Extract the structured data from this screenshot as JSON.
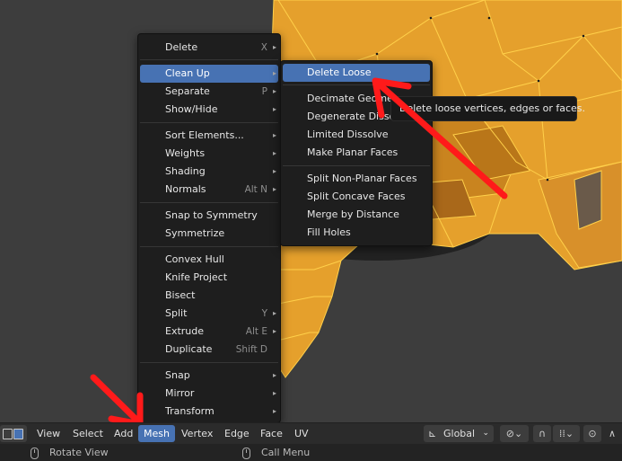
{
  "mesh_menu": {
    "items": [
      {
        "label": "Delete",
        "shortcut": "X",
        "arrow": "▸"
      },
      {
        "label": "Clean Up",
        "shortcut": "",
        "arrow": "▸"
      },
      {
        "label": "Separate",
        "shortcut": "P",
        "arrow": "▸"
      },
      {
        "label": "Show/Hide",
        "shortcut": "",
        "arrow": "▸"
      },
      {
        "label": "Sort Elements...",
        "shortcut": "",
        "arrow": "▸"
      },
      {
        "label": "Weights",
        "shortcut": "",
        "arrow": "▸"
      },
      {
        "label": "Shading",
        "shortcut": "",
        "arrow": "▸"
      },
      {
        "label": "Normals",
        "shortcut": "Alt N",
        "arrow": "▸"
      },
      {
        "label": "Snap to Symmetry",
        "shortcut": "",
        "arrow": ""
      },
      {
        "label": "Symmetrize",
        "shortcut": "",
        "arrow": ""
      },
      {
        "label": "Convex Hull",
        "shortcut": "",
        "arrow": ""
      },
      {
        "label": "Knife Project",
        "shortcut": "",
        "arrow": ""
      },
      {
        "label": "Bisect",
        "shortcut": "",
        "arrow": ""
      },
      {
        "label": "Split",
        "shortcut": "Y",
        "arrow": "▸"
      },
      {
        "label": "Extrude",
        "shortcut": "Alt E",
        "arrow": "▸"
      },
      {
        "label": "Duplicate",
        "shortcut": "Shift D",
        "arrow": ""
      },
      {
        "label": "Snap",
        "shortcut": "",
        "arrow": "▸"
      },
      {
        "label": "Mirror",
        "shortcut": "",
        "arrow": "▸"
      },
      {
        "label": "Transform",
        "shortcut": "",
        "arrow": "▸"
      }
    ]
  },
  "cleanup_menu": {
    "items": [
      {
        "label": "Delete Loose"
      },
      {
        "label": "Decimate Geometry"
      },
      {
        "label": "Degenerate Dissolve"
      },
      {
        "label": "Limited Dissolve"
      },
      {
        "label": "Make Planar Faces"
      },
      {
        "label": "Split Non-Planar Faces"
      },
      {
        "label": "Split Concave Faces"
      },
      {
        "label": "Merge by Distance"
      },
      {
        "label": "Fill Holes"
      }
    ]
  },
  "tooltip": {
    "text": "Delete loose vertices, edges or faces."
  },
  "header": {
    "menus": [
      "View",
      "Select",
      "Add",
      "Mesh",
      "Vertex",
      "Edge",
      "Face",
      "UV"
    ],
    "active_menu": "Mesh",
    "orientation": "Global"
  },
  "status_bar": {
    "left": "Rotate View",
    "middle": "Call Menu"
  },
  "colors": {
    "accent": "#4772b3",
    "mesh_fill": "#e5a02c",
    "mesh_wire": "#ffd04a",
    "arrow": "#ff1a1a"
  },
  "icons": {
    "arrow_submenu": "chevron-right-icon",
    "orientation": "transform-orientation-icon",
    "pivot": "pivot-point-icon",
    "snap": "snap-magnet-icon",
    "proportional": "proportional-edit-icon",
    "falloff": "falloff-curve-icon"
  }
}
